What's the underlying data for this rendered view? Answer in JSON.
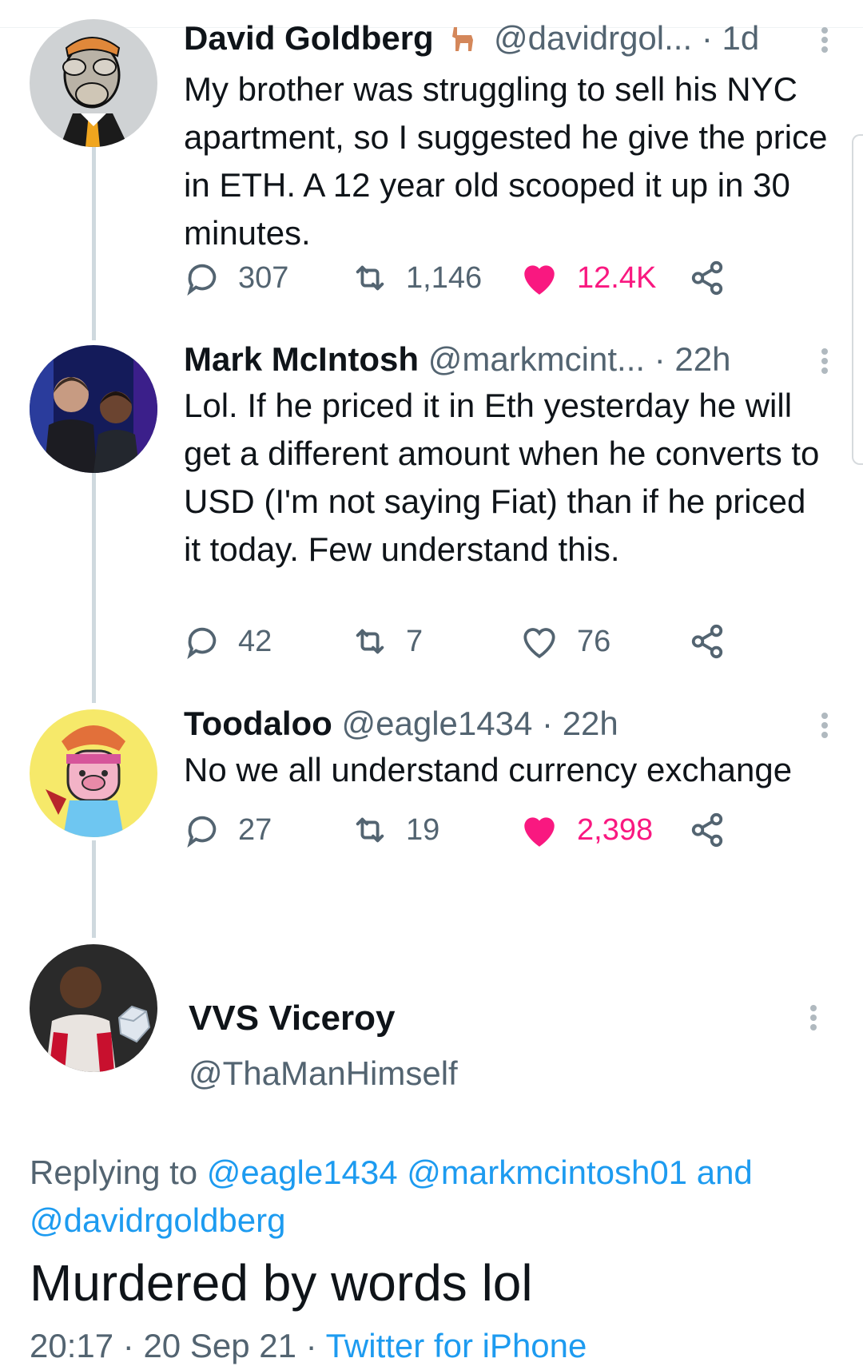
{
  "thread": [
    {
      "name": "David Goldberg",
      "badge_icon": "alpaca-icon",
      "handle": "@davidrgol...",
      "time": "1d",
      "text": "My brother was struggling to sell his NYC apartment, so I suggested he give the price in ETH. A 12 year old scooped it up in 30 minutes.",
      "replies": "307",
      "retweets": "1,146",
      "likes": "12.4K",
      "liked": true
    },
    {
      "name": "Mark McIntosh",
      "handle": "@markmcint...",
      "time": "22h",
      "text": "Lol. If he priced it in Eth yesterday he will get a different amount when he converts to USD (I'm not saying Fiat) than if he priced it today. Few understand this.",
      "replies": "42",
      "retweets": "7",
      "likes": "76",
      "liked": false
    },
    {
      "name": "Toodaloo",
      "handle": "@eagle1434",
      "time": "22h",
      "text": "No we all understand currency exchange",
      "replies": "27",
      "retweets": "19",
      "likes": "2,398",
      "liked": true
    }
  ],
  "focus": {
    "name": "VVS Viceroy",
    "handle": "@ThaManHimself",
    "replying_prefix": "Replying to",
    "replying_handles": "@eagle1434 @markmcintosh01",
    "replying_and": "and",
    "replying_last": "@davidrgoldberg",
    "text": "Murdered by words lol",
    "time": "20:17",
    "date": "20 Sep 21",
    "source": "Twitter for iPhone"
  },
  "separators": {
    "dot": "·"
  },
  "colors": {
    "like_pink": "#f91880",
    "link_blue": "#1d9bf0",
    "secondary_gray": "#536471",
    "thread_line": "#cfd9de"
  },
  "icons": [
    "reply-icon",
    "retweet-icon",
    "heart-icon",
    "share-icon",
    "more-icon",
    "alpaca-icon"
  ]
}
